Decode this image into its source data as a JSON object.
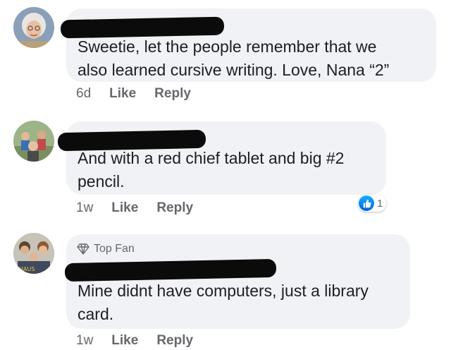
{
  "comments": [
    {
      "text_lines": [
        "Sweetie, let the people remember that we",
        "also learned cursive writing.  Love, Nana “2”"
      ],
      "time": "6d",
      "like_label": "Like",
      "reply_label": "Reply",
      "avatar_icon": "elderly-woman-avatar"
    },
    {
      "text_lines": [
        "And with a red chief tablet and big #2",
        "pencil."
      ],
      "time": "1w",
      "like_label": "Like",
      "reply_label": "Reply",
      "reaction_count": "1",
      "avatar_icon": "family-photo-avatar"
    },
    {
      "badge": "Top Fan",
      "badge_icon": "diamond-icon",
      "text_lines": [
        "Mine didnt have computers, just a library",
        "card."
      ],
      "time": "1w",
      "like_label": "Like",
      "reply_label": "Reply",
      "avatar_icon": "group-photo-avatar"
    }
  ],
  "colors": {
    "bubble": "#f0f2f5",
    "text": "#1c1e21",
    "secondary": "#65676b",
    "like_blue": "#1877f2"
  }
}
